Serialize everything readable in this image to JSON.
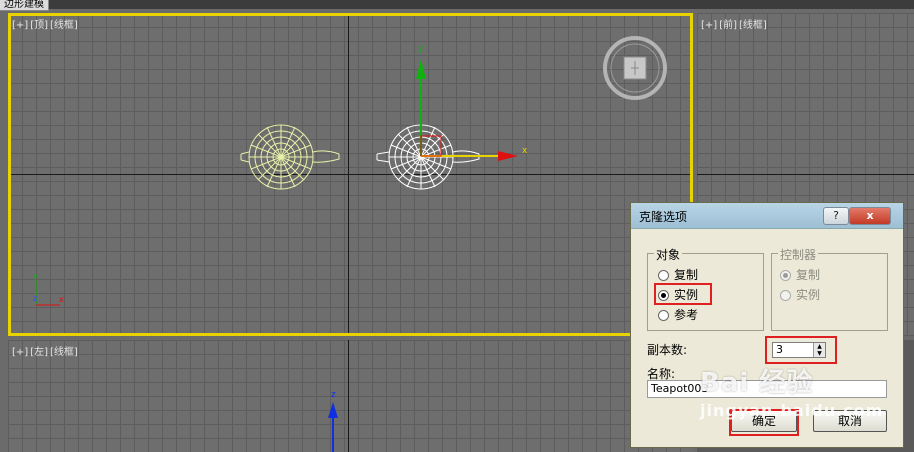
{
  "app": {
    "mode_tab": "边形建模"
  },
  "viewports": {
    "top": {
      "plus": "[+]",
      "view": "[顶]",
      "shading": "[线框]"
    },
    "front": {
      "plus": "[+]",
      "view": "[前]",
      "shading": "[线框]"
    },
    "left": {
      "plus": "[+]",
      "view": "[左]",
      "shading": "[线框]"
    }
  },
  "gizmo": {
    "x": "x",
    "y": "y",
    "z": "z"
  },
  "dialog": {
    "title": "克隆选项",
    "help_btn": "?",
    "close_btn": "x",
    "object_group": {
      "legend": "对象",
      "options": [
        {
          "label": "复制",
          "checked": false
        },
        {
          "label": "实例",
          "checked": true
        },
        {
          "label": "参考",
          "checked": false
        }
      ]
    },
    "controller_group": {
      "legend": "控制器",
      "options": [
        {
          "label": "复制",
          "checked": true
        },
        {
          "label": "实例",
          "checked": false
        }
      ]
    },
    "copies_label": "副本数:",
    "copies_value": "3",
    "name_label": "名称:",
    "name_value": "Teapot003",
    "ok_label": "确定",
    "cancel_label": "取消"
  },
  "watermark": {
    "logo": "Bai 经验",
    "url": "jingyan.baidu.com"
  },
  "colors": {
    "active_border": "#e8d200",
    "highlight": "#e02020",
    "wire_yellow": "#e8f0a8",
    "gizmo_x": "#e01010",
    "gizmo_y": "#10b010",
    "gizmo_z": "#1030e0"
  }
}
